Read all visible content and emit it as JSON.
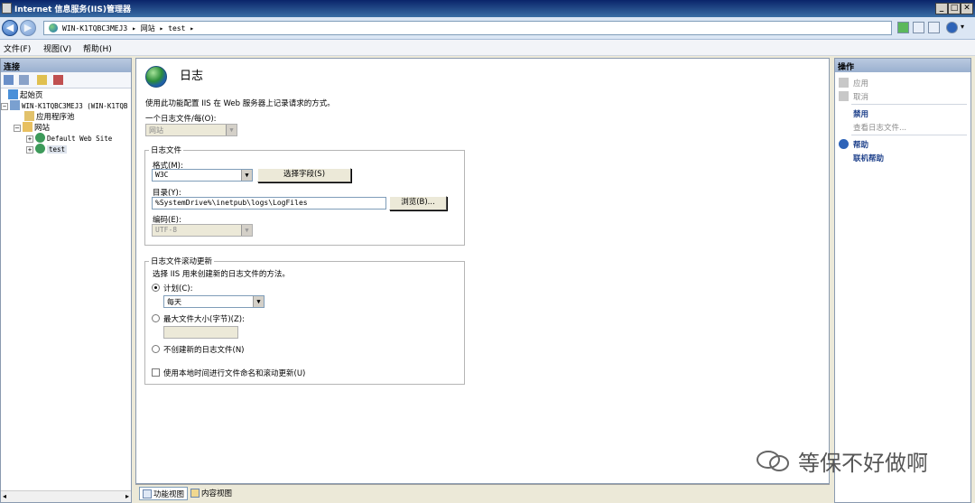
{
  "window": {
    "title": "Internet 信息服务(IIS)管理器"
  },
  "address": {
    "crumbs": "WIN-K1TQBC3MEJ3  ▸  网站  ▸  test  ▸"
  },
  "menu": {
    "file": "文件(F)",
    "view": "视图(V)",
    "help": "帮助(H)"
  },
  "connections": {
    "header": "连接",
    "tree": {
      "start_page": "起始页",
      "server": "WIN-K1TQBC3MEJ3 (WIN-K1TQB",
      "app_pools": "应用程序池",
      "sites": "网站",
      "default_site": "Default Web Site",
      "test_site": "test"
    }
  },
  "feature": {
    "title": "日志",
    "description": "使用此功能配置 IIS 在 Web 服务器上记录请求的方式。",
    "one_log_label": "一个日志文件/每(O):",
    "one_log_value": "网站",
    "log_file": {
      "legend": "日志文件",
      "format_label": "格式(M):",
      "format_value": "W3C",
      "select_fields_button": "选择字段(S)",
      "directory_label": "目录(Y):",
      "directory_value": "%SystemDrive%\\inetpub\\logs\\LogFiles",
      "browse_button": "浏览(B)...",
      "encoding_label": "编码(E):",
      "encoding_value": "UTF-8"
    },
    "rollover": {
      "legend": "日志文件滚动更新",
      "description": "选择 IIS 用来创建新的日志文件的方法。",
      "schedule_label": "计划(C):",
      "schedule_value": "每天",
      "max_size_label": "最大文件大小(字节)(Z):",
      "no_new_label": "不创建新的日志文件(N)",
      "local_time_label": "使用本地时间进行文件命名和滚动更新(U)"
    }
  },
  "views": {
    "features": "功能视图",
    "content": "内容视图"
  },
  "actions": {
    "header": "操作",
    "apply": "应用",
    "cancel": "取消",
    "disable": "禁用",
    "view_logs": "查看日志文件...",
    "help": "帮助",
    "online_help": "联机帮助"
  },
  "watermark": "等保不好做啊"
}
